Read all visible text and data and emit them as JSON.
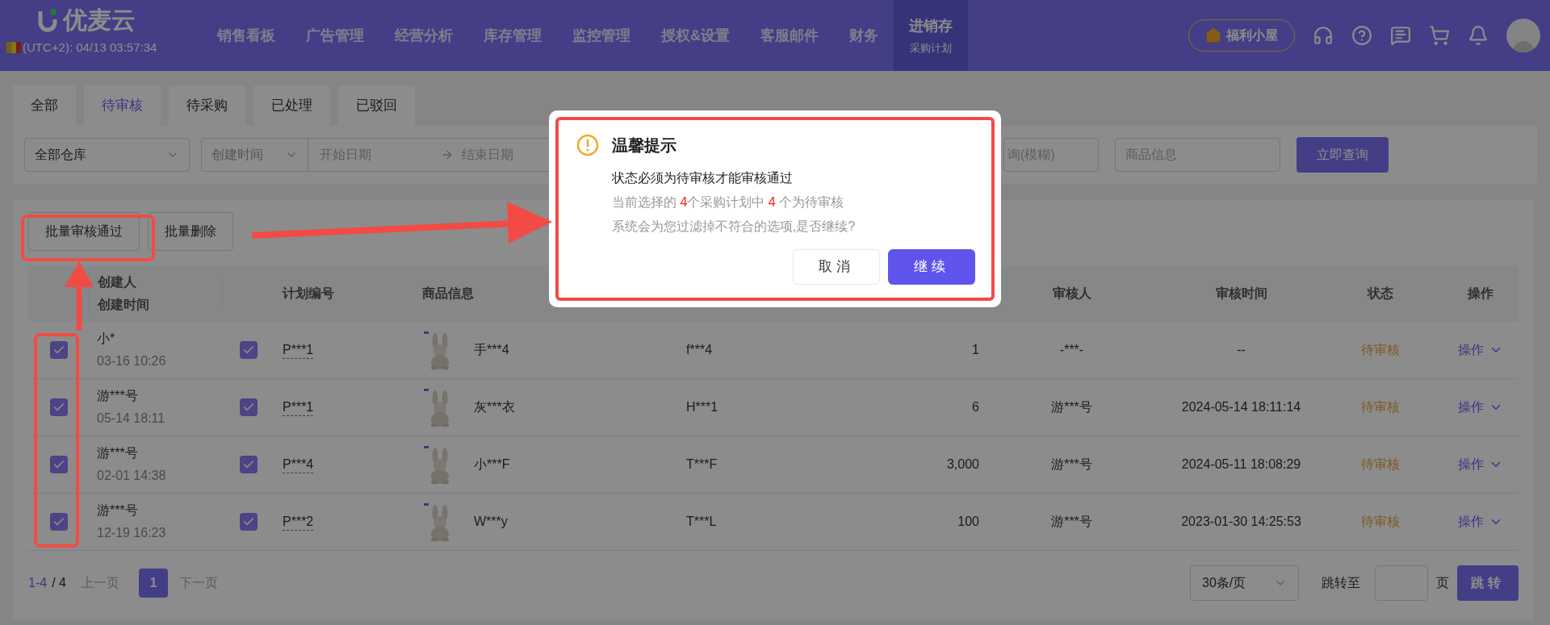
{
  "header": {
    "logo": "优麦云",
    "clock": "(UTC+2): 04/13 03:57:34",
    "promo_button": "福利小屋",
    "nav": [
      {
        "label": "销售看板",
        "selected": false
      },
      {
        "label": "广告管理",
        "selected": false
      },
      {
        "label": "经营分析",
        "selected": false
      },
      {
        "label": "库存管理",
        "selected": false
      },
      {
        "label": "监控管理",
        "selected": false
      },
      {
        "label": "授权&设置",
        "selected": false
      },
      {
        "label": "客服邮件",
        "selected": false
      },
      {
        "label": "财务",
        "selected": false
      },
      {
        "label": "进销存",
        "selected": true,
        "subtitle": "采购计划"
      }
    ]
  },
  "tabs": [
    {
      "label": "全部",
      "selected": false
    },
    {
      "label": "待审核",
      "selected": true
    },
    {
      "label": "待采购",
      "selected": false
    },
    {
      "label": "已处理",
      "selected": false
    },
    {
      "label": "已驳回",
      "selected": false
    }
  ],
  "filters": {
    "warehouse": "全部仓库",
    "date_type": "创建时间",
    "start_placeholder": "开始日期",
    "end_placeholder": "结束日期",
    "keyword_placeholder": "询(模糊)",
    "product_placeholder": "商品信息",
    "search_button": "立即查询"
  },
  "actions": [
    "批量审核通过",
    "批量删除"
  ],
  "table": {
    "columns": {
      "creator": "创建人",
      "created": "创建时间",
      "plan_no": "计划编号",
      "product": "商品信息",
      "reviewer": "审核人",
      "review_time": "审核时间",
      "status": "状态",
      "action": "操作"
    },
    "rows": [
      {
        "checked": true,
        "creator": "小*",
        "created": "03-16 10:26",
        "plan_checked": true,
        "plan_no": "P***1",
        "product": "手***4",
        "column_6": "f***4",
        "quantity": "1",
        "reviewer": "-***-",
        "review_time": "--",
        "status": "待审核",
        "action": "操作"
      },
      {
        "checked": true,
        "creator": "游***号",
        "created": "05-14 18:11",
        "plan_checked": true,
        "plan_no": "P***1",
        "product": "灰***衣",
        "column_6": "H***1",
        "quantity": "6",
        "reviewer": "游***号",
        "review_time": "2024-05-14 18:11:14",
        "status": "待审核",
        "action": "操作"
      },
      {
        "checked": true,
        "creator": "游***号",
        "created": "02-01 14:38",
        "plan_checked": true,
        "plan_no": "P***4",
        "product": "小***F",
        "column_6": "T***F",
        "quantity": "3,000",
        "reviewer": "游***号",
        "review_time": "2024-05-11 18:08:29",
        "status": "待审核",
        "action": "操作"
      },
      {
        "checked": true,
        "creator": "游***号",
        "created": "12-19 16:23",
        "plan_checked": true,
        "plan_no": "P***2",
        "product": "W***y",
        "column_6": "T***L",
        "quantity": "100",
        "reviewer": "游***号",
        "review_time": "2023-01-30 14:25:53",
        "status": "待审核",
        "action": "操作"
      }
    ]
  },
  "pagination": {
    "range": "1-4",
    "total": "/ 4",
    "prev": "上一页",
    "pages": [
      {
        "label": "1",
        "selected": true
      }
    ],
    "next": "下一页",
    "page_size": "30条/页",
    "jump_label": "跳转至",
    "page_unit": "页",
    "jump_button": "跳转"
  },
  "dialog": {
    "title": "温馨提示",
    "message": "状态必须为待审核才能审核通过",
    "detail": [
      {
        "kind": "plain",
        "text": "当前选择的 "
      },
      {
        "kind": "count",
        "text": "4"
      },
      {
        "kind": "plain",
        "text": "个采购计划中 "
      },
      {
        "kind": "count",
        "text": "4"
      },
      {
        "kind": "plain",
        "text": " 个为待审核"
      }
    ],
    "note": "系统会为您过滤掉不符合的选项,是否继续?",
    "cancel": "取消",
    "confirm": "继续"
  }
}
